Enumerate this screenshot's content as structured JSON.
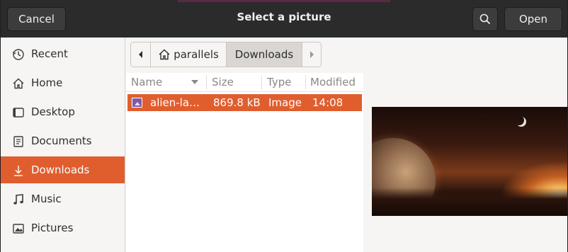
{
  "header": {
    "title": "Select a picture",
    "cancel_label": "Cancel",
    "open_label": "Open",
    "search_icon": "search-icon"
  },
  "sidebar": {
    "items": [
      {
        "label": "Recent",
        "icon": "clock-icon"
      },
      {
        "label": "Home",
        "icon": "home-icon"
      },
      {
        "label": "Desktop",
        "icon": "desktop-icon"
      },
      {
        "label": "Documents",
        "icon": "document-icon"
      },
      {
        "label": "Downloads",
        "icon": "download-icon",
        "active": true
      },
      {
        "label": "Music",
        "icon": "music-icon"
      },
      {
        "label": "Pictures",
        "icon": "pictures-icon"
      }
    ]
  },
  "pathbar": {
    "segments": [
      "parallels",
      "Downloads"
    ]
  },
  "list": {
    "columns": [
      "Name",
      "Size",
      "Type",
      "Modified"
    ],
    "rows": [
      {
        "name": "alien-la…",
        "size": "869.8 kB",
        "type": "Image",
        "modified": "14:08",
        "selected": true
      }
    ]
  },
  "colors": {
    "accent": "#e05e2e",
    "header_bg": "#2b2b2b",
    "sidebar_bg": "#f6f5f4"
  }
}
